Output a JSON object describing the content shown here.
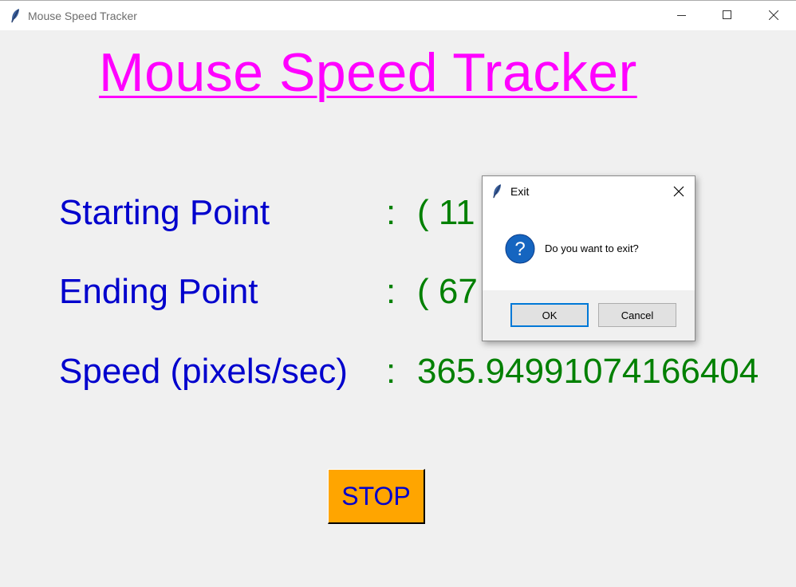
{
  "window": {
    "title": "Mouse Speed Tracker",
    "icon": "feather-icon",
    "controls": [
      "minimize-icon",
      "maximize-icon",
      "close-icon"
    ]
  },
  "main": {
    "heading": "Mouse Speed Tracker",
    "rows": [
      {
        "label": "Starting Point",
        "separator": ":",
        "value": "( 11"
      },
      {
        "label": "Ending Point",
        "separator": ":",
        "value": "( 67"
      },
      {
        "label": "Speed (pixels/sec)",
        "separator": ":",
        "value": "365.94991074166404"
      }
    ],
    "stop_label": "STOP"
  },
  "dialog": {
    "title": "Exit",
    "icon": "question-icon",
    "message": "Do you want to exit?",
    "ok_label": "OK",
    "cancel_label": "Cancel"
  },
  "colors": {
    "heading": "#ff00ff",
    "label": "#0000cd",
    "value": "#008000",
    "stop_button_bg": "#ffa500",
    "dialog_accent": "#0078d7"
  }
}
